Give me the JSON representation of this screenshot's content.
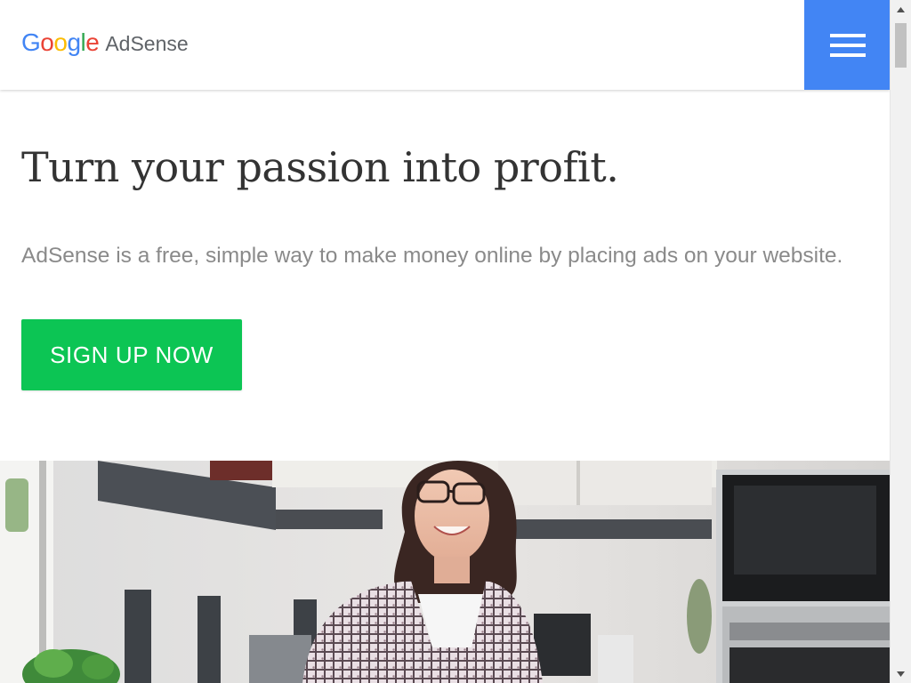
{
  "header": {
    "logo_letters": [
      "G",
      "o",
      "o",
      "g",
      "l",
      "e"
    ],
    "logo_colors": [
      "#4285f4",
      "#ea4335",
      "#fbbc05",
      "#4285f4",
      "#34a853",
      "#ea4335"
    ],
    "product_name": "AdSense",
    "menu_icon": "hamburger-menu-icon",
    "menu_color": "#4285f4"
  },
  "hero": {
    "headline": "Turn your passion into profit.",
    "subtext": "AdSense is a free, simple way to make money online by placing ads on your website.",
    "cta_label": "SIGN UP NOW",
    "cta_color": "#0cc554"
  },
  "scrollbar": {
    "up_icon": "scroll-up-arrow-icon",
    "down_icon": "scroll-down-arrow-icon"
  }
}
